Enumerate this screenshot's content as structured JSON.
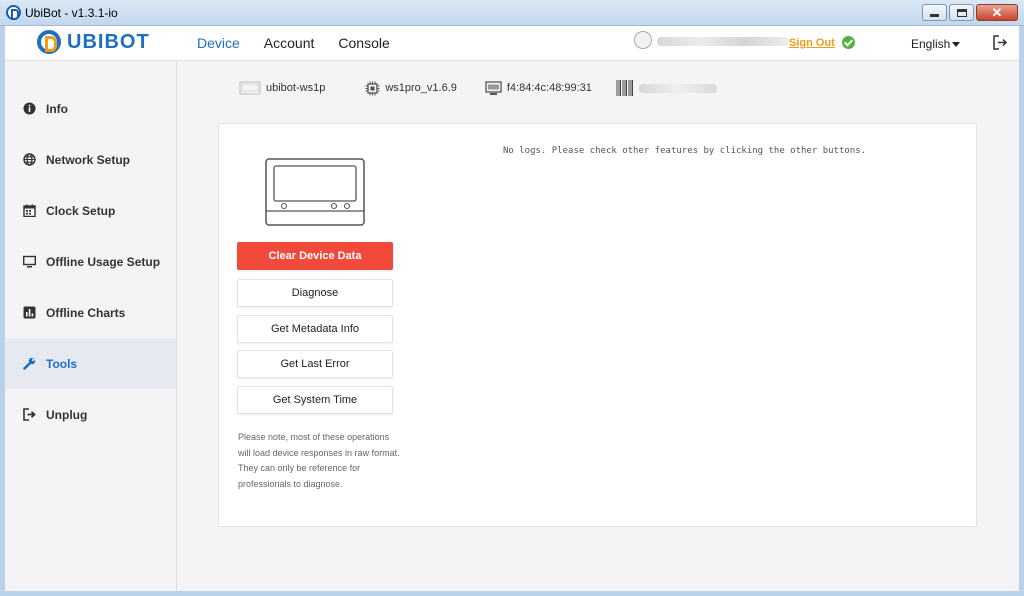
{
  "window": {
    "title": "UbiBot - v1.3.1-io"
  },
  "header": {
    "logo_text": "UBIBOT",
    "nav": [
      "Device",
      "Account",
      "Console"
    ],
    "active_nav": "Device",
    "sign_out": "Sign Out",
    "language": "English"
  },
  "sidebar": {
    "items": [
      {
        "label": "Info",
        "icon": "info-icon"
      },
      {
        "label": "Network Setup",
        "icon": "globe-icon"
      },
      {
        "label": "Clock Setup",
        "icon": "calendar-icon"
      },
      {
        "label": "Offline Usage Setup",
        "icon": "monitor-icon"
      },
      {
        "label": "Offline Charts",
        "icon": "bar-chart-icon"
      },
      {
        "label": "Tools",
        "icon": "wrench-icon"
      },
      {
        "label": "Unplug",
        "icon": "unplug-icon"
      }
    ],
    "active": "Tools"
  },
  "device_info": {
    "name": "ubibot-ws1p",
    "firmware": "ws1pro_v1.6.9",
    "mac": "f4:84:4c:48:99:31"
  },
  "tools": {
    "buttons": [
      "Clear Device Data",
      "Diagnose",
      "Get Metadata Info",
      "Get Last Error",
      "Get System Time"
    ],
    "note": "Please note, most of these operations will load device responses in raw format. They can only be reference for professionals to diagnose.",
    "logs": "No logs. Please check other features by clicking the other buttons."
  },
  "colors": {
    "accent": "#1e6fc2",
    "danger": "#f24a3a",
    "signout": "#f39a1b",
    "online": "#52b13f"
  }
}
